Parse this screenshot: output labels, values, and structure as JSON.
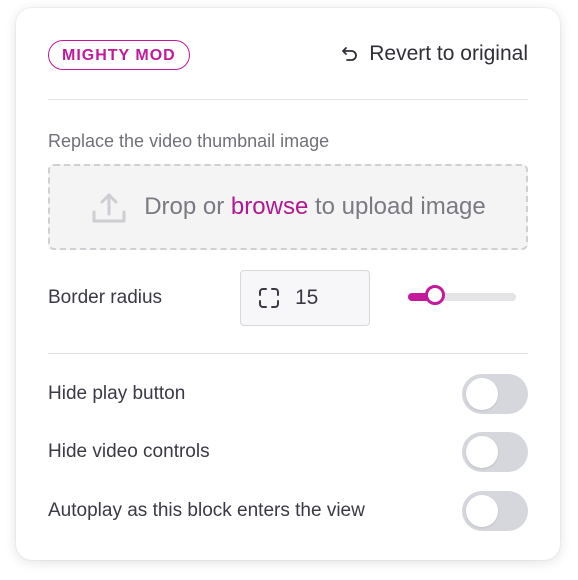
{
  "header": {
    "badge": "MIGHTY MOD",
    "revert_label": "Revert to original"
  },
  "thumbnail": {
    "label": "Replace the video thumbnail image",
    "drop_prefix": "Drop or ",
    "drop_link": "browse",
    "drop_suffix": " to upload image"
  },
  "border_radius": {
    "label": "Border radius",
    "value": "15",
    "slider_fraction": 0.25
  },
  "toggles": [
    {
      "label": "Hide play button",
      "on": false
    },
    {
      "label": "Hide video controls",
      "on": false
    },
    {
      "label": "Autoplay as this block enters the view",
      "on": false
    }
  ],
  "colors": {
    "accent": "#c21a9b",
    "toggle_off": "#d5d7dd"
  },
  "icons": {
    "revert": "undo-arrow-icon",
    "upload": "upload-icon",
    "radius": "corner-radius-icon"
  }
}
